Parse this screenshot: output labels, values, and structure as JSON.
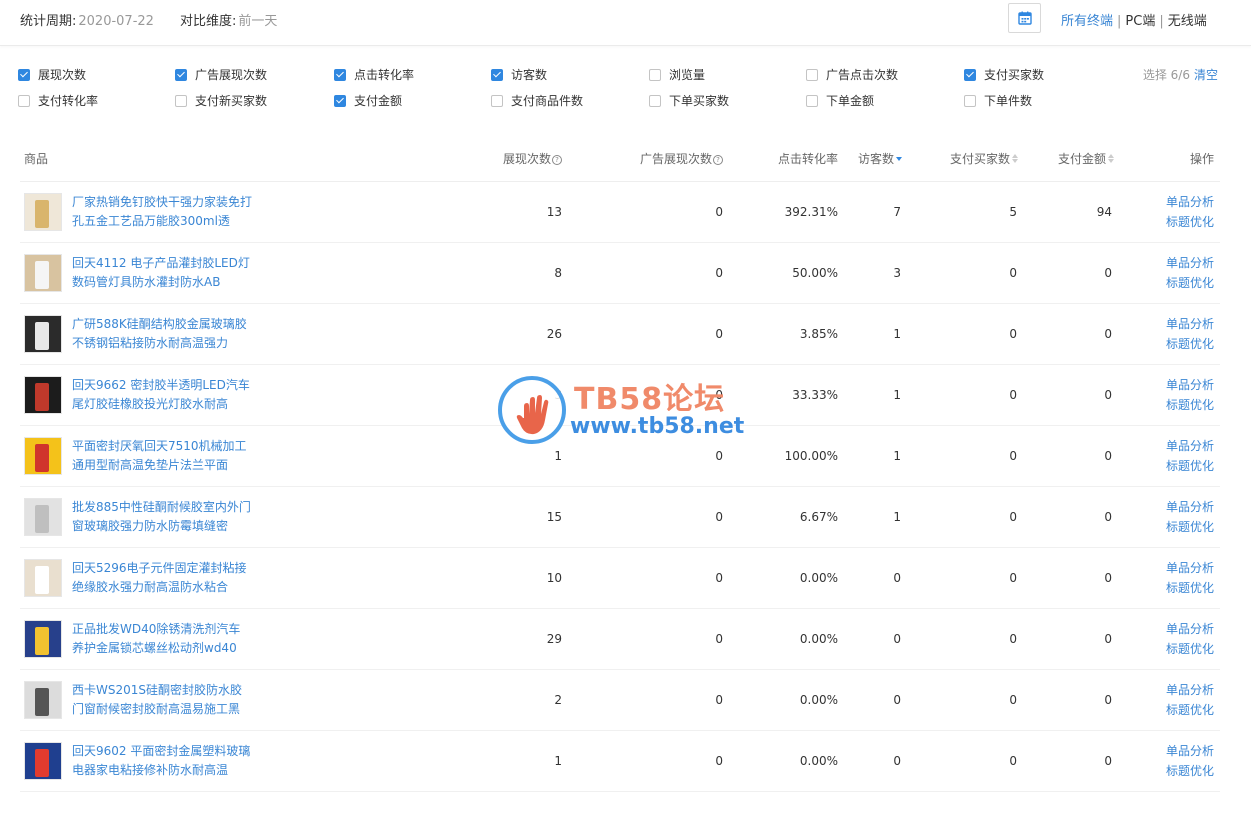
{
  "header": {
    "period_label": "统计周期:",
    "period_value": "2020-07-22",
    "compare_label": "对比维度:",
    "compare_value": "前一天",
    "terminals": [
      "所有终端",
      "PC端",
      "无线端"
    ],
    "active_terminal": "所有终端"
  },
  "filters": {
    "row1": [
      {
        "label": "展现次数",
        "checked": true
      },
      {
        "label": "广告展现次数",
        "checked": true
      },
      {
        "label": "点击转化率",
        "checked": true
      },
      {
        "label": "访客数",
        "checked": true
      },
      {
        "label": "浏览量",
        "checked": false
      },
      {
        "label": "广告点击次数",
        "checked": false
      },
      {
        "label": "支付买家数",
        "checked": true
      }
    ],
    "row2": [
      {
        "label": "支付转化率",
        "checked": false
      },
      {
        "label": "支付新买家数",
        "checked": false
      },
      {
        "label": "支付金额",
        "checked": true
      },
      {
        "label": "支付商品件数",
        "checked": false
      },
      {
        "label": "下单买家数",
        "checked": false
      },
      {
        "label": "下单金额",
        "checked": false
      },
      {
        "label": "下单件数",
        "checked": false
      }
    ],
    "selected_text": "选择 6/6",
    "clear_label": "清空"
  },
  "table": {
    "columns": {
      "goods": "商品",
      "impressions": "展现次数",
      "ad_impressions": "广告展现次数",
      "ctr": "点击转化率",
      "visitors": "访客数",
      "buyers": "支付买家数",
      "amount": "支付金额",
      "ops": "操作"
    },
    "op_labels": {
      "analysis": "单品分析",
      "title_opt": "标题优化"
    },
    "rows": [
      {
        "name": "厂家热销免钉胶快干强力家装免打孔五金工艺品万能胶300ml透",
        "impressions": "13",
        "ad_impressions": "0",
        "ctr": "392.31%",
        "visitors": "7",
        "buyers": "5",
        "amount": "94",
        "thumb_bg": "#efe7d8",
        "thumb_fg": "#d9b56c"
      },
      {
        "name": "回天4112 电子产品灌封胶LED灯数码管灯具防水灌封防水AB",
        "impressions": "8",
        "ad_impressions": "0",
        "ctr": "50.00%",
        "visitors": "3",
        "buyers": "0",
        "amount": "0",
        "thumb_bg": "#d8c3a0",
        "thumb_fg": "#f5f5f5"
      },
      {
        "name": "广研588K硅酮结构胶金属玻璃胶不锈钢铝粘接防水耐高温强力",
        "impressions": "26",
        "ad_impressions": "0",
        "ctr": "3.85%",
        "visitors": "1",
        "buyers": "0",
        "amount": "0",
        "thumb_bg": "#2b2b2b",
        "thumb_fg": "#e8e8e8"
      },
      {
        "name": "回天9662 密封胶半透明LED汽车尾灯胶硅橡胶投光灯胶水耐高",
        "impressions": "3",
        "ad_impressions": "0",
        "ctr": "33.33%",
        "visitors": "1",
        "buyers": "0",
        "amount": "0",
        "thumb_bg": "#1c1c1c",
        "thumb_fg": "#c0392b"
      },
      {
        "name": "平面密封厌氧回天7510机械加工通用型耐高温免垫片法兰平面",
        "impressions": "1",
        "ad_impressions": "0",
        "ctr": "100.00%",
        "visitors": "1",
        "buyers": "0",
        "amount": "0",
        "thumb_bg": "#f4c21a",
        "thumb_fg": "#d0342c"
      },
      {
        "name": "批发885中性硅酮耐候胶室内外门窗玻璃胶强力防水防霉填缝密",
        "impressions": "15",
        "ad_impressions": "0",
        "ctr": "6.67%",
        "visitors": "1",
        "buyers": "0",
        "amount": "0",
        "thumb_bg": "#e2e2e2",
        "thumb_fg": "#bfbfbf"
      },
      {
        "name": "回天5296电子元件固定灌封粘接绝缘胶水强力耐高温防水粘合",
        "impressions": "10",
        "ad_impressions": "0",
        "ctr": "0.00%",
        "visitors": "0",
        "buyers": "0",
        "amount": "0",
        "thumb_bg": "#e9dfcf",
        "thumb_fg": "#ffffff"
      },
      {
        "name": "正品批发WD40除锈清洗剂汽车养护金属锁芯螺丝松动剂wd40",
        "impressions": "29",
        "ad_impressions": "0",
        "ctr": "0.00%",
        "visitors": "0",
        "buyers": "0",
        "amount": "0",
        "thumb_bg": "#27408b",
        "thumb_fg": "#f2c230"
      },
      {
        "name": "西卡WS201S硅酮密封胶防水胶门窗耐候密封胶耐高温易施工黑",
        "impressions": "2",
        "ad_impressions": "0",
        "ctr": "0.00%",
        "visitors": "0",
        "buyers": "0",
        "amount": "0",
        "thumb_bg": "#dcdcdc",
        "thumb_fg": "#555555"
      },
      {
        "name": "回天9602 平面密封金属塑料玻璃电器家电粘接修补防水耐高温",
        "impressions": "1",
        "ad_impressions": "0",
        "ctr": "0.00%",
        "visitors": "0",
        "buyers": "0",
        "amount": "0",
        "thumb_bg": "#1f3f8f",
        "thumb_fg": "#e23b2e"
      }
    ]
  },
  "watermark": {
    "title": "TB58论坛",
    "url": "www.tb58.net"
  },
  "colors": {
    "link": "#3a86d4",
    "checkbox": "#2f87e0",
    "watermark_title": "#f08a6a",
    "watermark_url": "#3d8de0"
  },
  "icons": {
    "calendar": "calendar-icon",
    "help": "help-icon",
    "sort": "sort-icon"
  }
}
